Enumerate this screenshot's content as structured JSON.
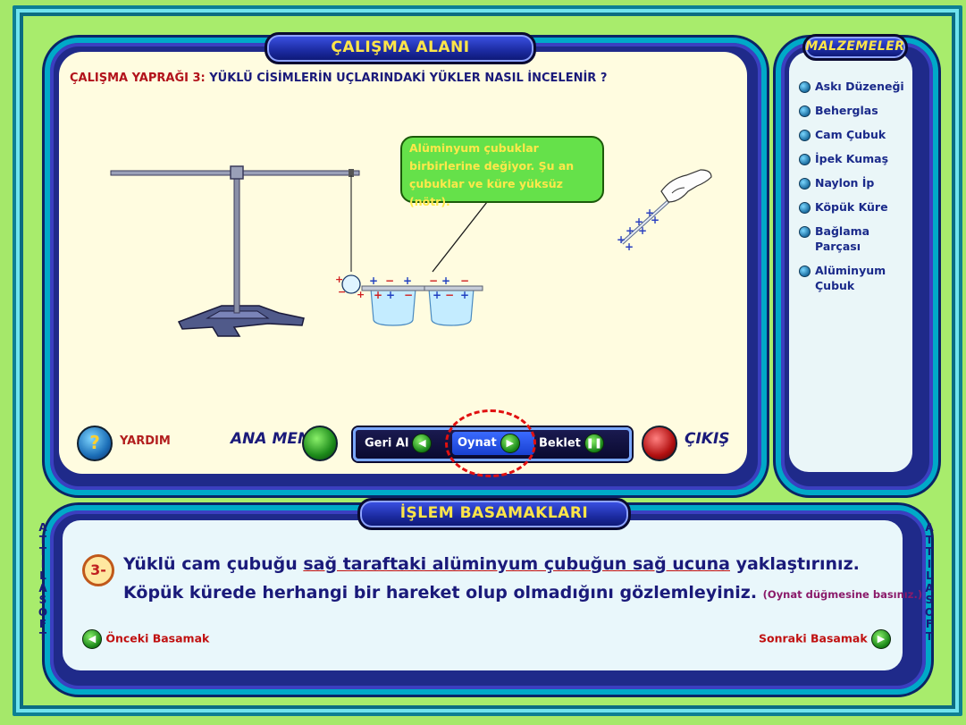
{
  "header": {
    "workarea_title": "ÇALIŞMA ALANI",
    "materials_title": "MALZEMELER",
    "steps_title": "İŞLEM BASAMAKLARI"
  },
  "worksheet": {
    "label": "ÇALIŞMA YAPRAĞI 3:",
    "question": "YÜKLÜ CİSİMLERİN UÇLARINDAKİ YÜKLER NASIL İNCELENİR ?"
  },
  "materials": [
    {
      "label": "Askı Düzeneği"
    },
    {
      "label": "Beherglas"
    },
    {
      "label": "Cam Çubuk"
    },
    {
      "label": "İpek Kumaş"
    },
    {
      "label": "Naylon İp"
    },
    {
      "label": "Köpük Küre"
    },
    {
      "label": "Bağlama Parçası"
    },
    {
      "label": "Alüminyum Çubuk"
    }
  ],
  "bubble": {
    "text": "Alüminyum çubuklar birbirlerine değiyor. Şu an çubuklar ve küre yüksüz (nötr)."
  },
  "controls": {
    "help_label": "YARDIM",
    "main_menu_label": "ANA MENÜ",
    "exit_label": "ÇIKIŞ",
    "undo_label": "Geri Al",
    "play_label": "Oynat",
    "pause_label": "Beklet",
    "help_icon": "?"
  },
  "step": {
    "number": "3-",
    "line1_a": "Yüklü cam çubuğu ",
    "line1_b": "sağ taraftaki alüminyum çubuğun sağ  ucuna",
    "line1_c": " yaklaştırınız.",
    "line2": "Köpük kürede herhangi bir hareket olup olmadığını gözlemleyiniz.",
    "note": "(Oynat düğmesine basınız.)",
    "prev_label": "Önceki Basamak",
    "next_label": "Sonraki Basamak"
  },
  "brand": {
    "left": "ATTILASOFT",
    "right": "ATTILASOFT"
  },
  "colors": {
    "background": "#a5e86a",
    "panel_frame": "#1f2a8a",
    "title_text": "#ffe648",
    "bubble": "#65e14a",
    "highlight": "#e01010"
  }
}
